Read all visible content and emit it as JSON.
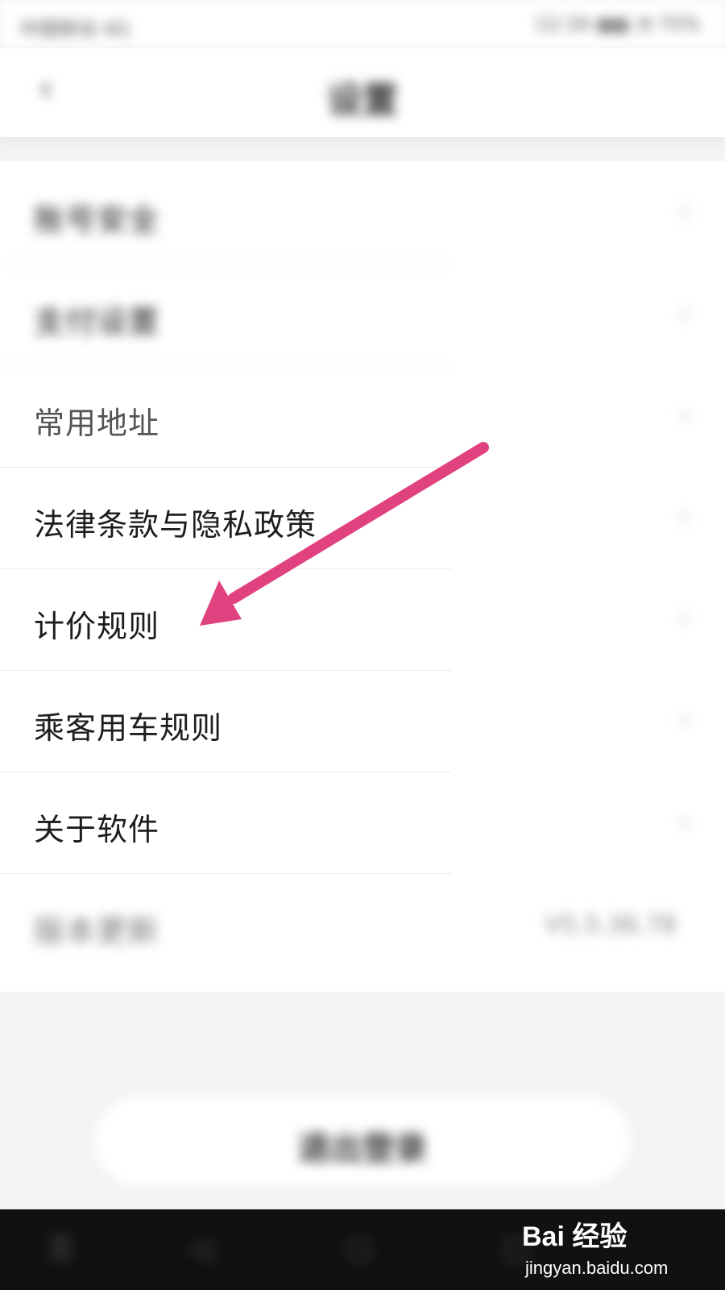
{
  "status_bar": {
    "carrier": "中国移动 4G",
    "icons": "12:34  ▮▮▮  ◔ 75%"
  },
  "nav": {
    "back_icon": "chevron-left-icon",
    "back_glyph": "‹",
    "title": "设置"
  },
  "settings": {
    "items": [
      {
        "label": "账号安全",
        "value": ""
      },
      {
        "label": "支付设置",
        "value": ""
      },
      {
        "label": "常用地址",
        "value": ""
      },
      {
        "label": "法律条款与隐私政策",
        "value": ""
      },
      {
        "label": "计价规则",
        "value": ""
      },
      {
        "label": "乘客用车规则",
        "value": ""
      },
      {
        "label": "关于软件",
        "value": ""
      },
      {
        "label": "版本更新",
        "value": "V5.5.36.78"
      }
    ],
    "chevron_glyph": "›"
  },
  "logout": {
    "label": "退出登录"
  },
  "bottom_nav": {
    "icons": [
      "◁",
      "○",
      "□",
      "☰"
    ]
  },
  "annotation": {
    "color": "#e0427f"
  },
  "watermark": {
    "brand": "Bai 经验",
    "url": "jingyan.baidu.com"
  }
}
